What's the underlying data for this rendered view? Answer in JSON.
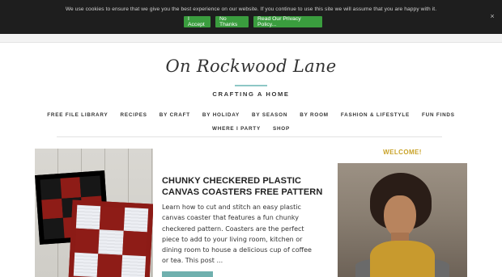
{
  "cookie_bar": {
    "message": "We use cookies to ensure that we give you the best experience on our website. If you continue to use this site we will assume that you are happy with it.",
    "accept_label": "I Accept",
    "reject_label": "No Thanks",
    "policy_label": "Read Our Privacy Policy...",
    "close_glyph": "×",
    "button_color": "#3a9d3e"
  },
  "header": {
    "logo_text": "On Rockwood Lane",
    "tagline": "CRAFTING A HOME",
    "accent_color": "#8ec7c6"
  },
  "nav": {
    "row1": [
      {
        "label": "FREE FILE LIBRARY"
      },
      {
        "label": "RECIPES"
      },
      {
        "label": "BY CRAFT"
      },
      {
        "label": "BY HOLIDAY"
      },
      {
        "label": "BY SEASON"
      },
      {
        "label": "BY ROOM"
      },
      {
        "label": "FASHION & LIFESTYLE"
      },
      {
        "label": "FUN FINDS"
      }
    ],
    "row2": [
      {
        "label": "WHERE I PARTY"
      },
      {
        "label": "SHOP"
      }
    ]
  },
  "post": {
    "title": "CHUNKY CHECKERED PLASTIC CANVAS COASTERS FREE PATTERN",
    "excerpt": "Learn how to cut and stitch an easy plastic canvas coaster that features a fun chunky checkered pattern. Coasters are the perfect piece to add to your living room, kitchen or dining room to house a delicious cup of coffee or tea. This post ...",
    "read_more_color": "#6fb0ae"
  },
  "sidebar": {
    "welcome": "WELCOME!",
    "welcome_color": "#c9a227"
  }
}
